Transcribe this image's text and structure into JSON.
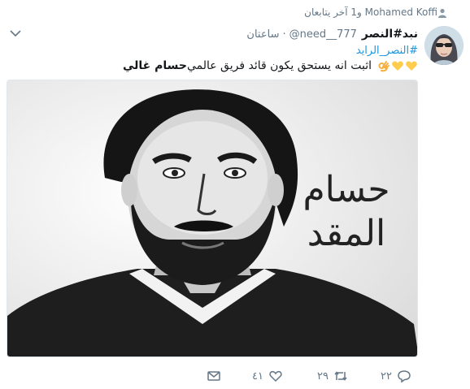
{
  "social_context": {
    "text": "Mohamed Koffi و1 آخر يتابعان",
    "icon": "person-icon"
  },
  "tweet": {
    "author_name": "نبد#النصر",
    "handle": "@need__777",
    "separator": "·",
    "time": "ساعتان",
    "hashtag": "#النصر_الرايد",
    "text_bold": "حسام غالي",
    "text_body": "اثبت انه يستحق  يكون قائد فريق عالمي",
    "emojis": [
      "ok-hand-emoji",
      "yellow-heart-emoji",
      "yellow-heart-emoji"
    ]
  },
  "media": {
    "caption_line1": "حسام",
    "caption_line2": "المقد"
  },
  "actions": {
    "reply_count": "٢٢",
    "retweet_count": "٢٩",
    "like_count": "٤١"
  },
  "colors": {
    "link": "#1b95e0",
    "secondary_text": "#657786",
    "border": "#e1e8ed",
    "heart": "#ffcc4d"
  }
}
